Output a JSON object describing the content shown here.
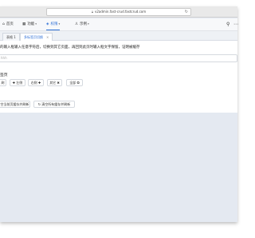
{
  "browser": {
    "url": "v2admin.fast-crud.fastcrud.com",
    "lock_icon": "lock-icon",
    "refresh_icon": "refresh-icon"
  },
  "nav": {
    "items": [
      {
        "label": "首页",
        "icon": "home-icon",
        "glyph": "⌂"
      },
      {
        "label": "功能",
        "icon": "grid-icon",
        "glyph": "▦",
        "caret": "▾"
      },
      {
        "label": "权限",
        "icon": "shield-icon",
        "glyph": "◈",
        "caret": "▾",
        "active": true
      },
      {
        "label": "示例",
        "icon": "user-icon",
        "glyph": "♙",
        "caret": "▾"
      }
    ],
    "right_icons": [
      {
        "name": "search-icon",
        "glyph": "⚲"
      },
      {
        "name": "more-icon",
        "glyph": "⋯"
      }
    ]
  },
  "tabs": [
    {
      "label": "表格 1",
      "active": false
    },
    {
      "label": "多标签页切换",
      "active": true,
      "close": "×"
    }
  ],
  "page": {
    "description": "的输入框输入任意字符后，切换到其它页面，再回到此页时输入框文字保留，证明被缓存",
    "input_placeholder": "hhh",
    "section_title": "签页",
    "action_buttons": [
      "刷",
      "✚ 左侧",
      "右侧 ✚",
      "其它 ✖",
      "全部 ✪"
    ],
    "bottom_buttons": [
      "空当前页缓存并刷新",
      "↻ 清空所有缓存并刷新"
    ]
  },
  "colors": {
    "accent": "#2d6fd6",
    "background": "#e4e9f1",
    "panel": "#ffffff"
  }
}
